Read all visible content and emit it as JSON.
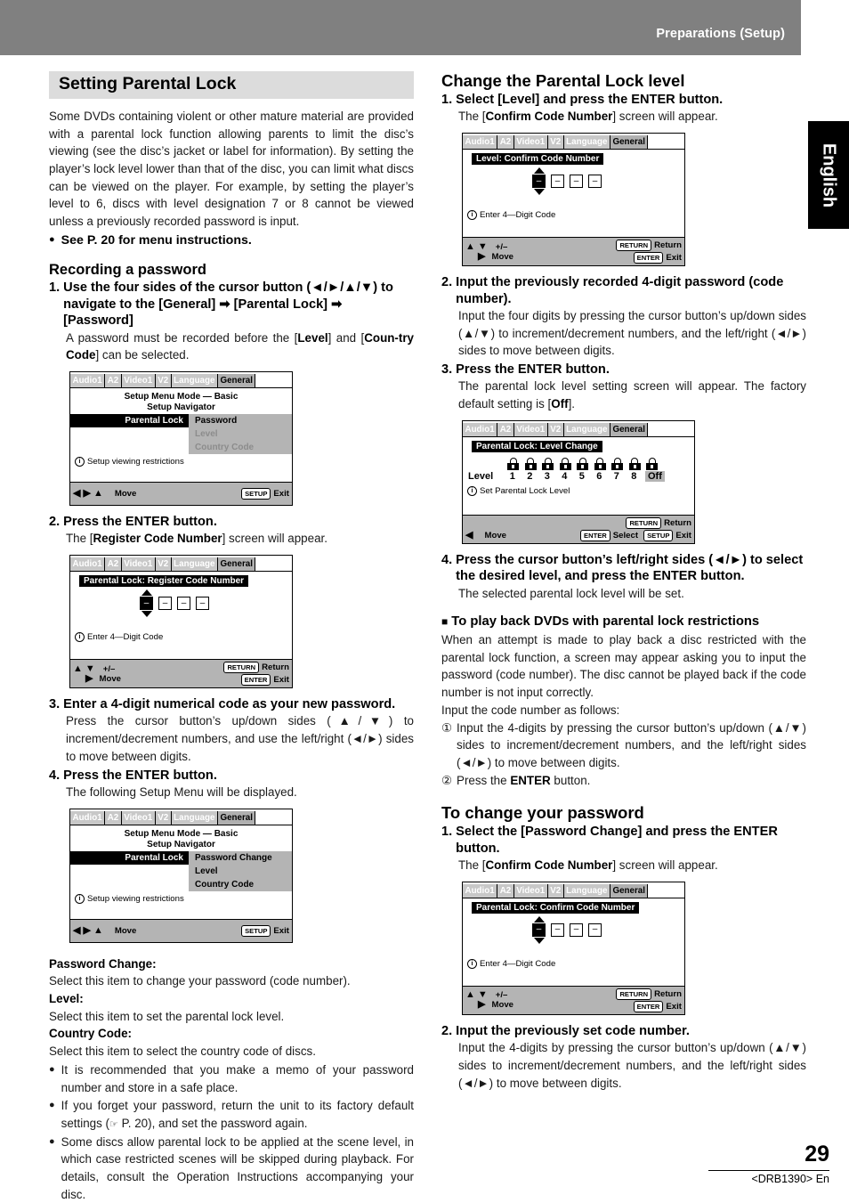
{
  "header": {
    "title": "Preparations (Setup)"
  },
  "sidetab": {
    "label": "English"
  },
  "footer": {
    "page_number": "29",
    "model": "<DRB1390> En"
  },
  "left": {
    "section_title": "Setting Parental Lock",
    "intro": "Some DVDs containing violent or other mature material are provided with a parental lock function allowing parents to limit the disc’s viewing (see the disc’s jacket or label for information). By setting the player’s lock level lower than that of the disc, you can limit what discs can be viewed on the player. For example, by setting the player’s level to 6, discs with level designation 7 or 8 cannot be viewed unless a previously recorded password is input.",
    "intro_bullet": "See P. 20 for menu instructions.",
    "sub_title": "Recording a password",
    "step1_num": "1.",
    "step1_title": "Use the four sides of the cursor button (◄/►/▲/▼) to navigate to the [General] ➡ [Parental Lock] ➡ [Password]",
    "step1_body_a": "A password must be recorded before the [",
    "step1_body_level": "Level",
    "step1_body_b": "] and [",
    "step1_body_country": "Coun-try Code",
    "step1_body_c": "] can be selected.",
    "step2_num": "2.",
    "step2_title": "Press the ENTER button.",
    "step2_body_a": "The [",
    "step2_body_b": "Register Code Number",
    "step2_body_c": "] screen will appear.",
    "step3_num": "3.",
    "step3_title": "Enter a 4-digit numerical code as your new password.",
    "step3_body": "Press the cursor button’s up/down sides (▲/▼) to increment/decrement numbers, and use the left/right (◄/►) sides to move between digits.",
    "step4_num": "4.",
    "step4_title": "Press the ENTER button.",
    "step4_body": "The following Setup Menu will be displayed.",
    "def_pwd_label": "Password Change:",
    "def_pwd_text": "Select this item to change your password (code number).",
    "def_level_label": "Level:",
    "def_level_text": "Select this item to set the parental lock level.",
    "def_country_label": "Country Code:",
    "def_country_text": "Select this item to select the country code of discs.",
    "bullet1": "It is recommended that you make a memo of your password number and store in a safe place.",
    "bullet2a": "If you forget your password, return the unit to its factory default settings (",
    "bullet2icon": "☞",
    "bullet2b": " P. 20), and set the password again.",
    "bullet3": "Some discs allow parental lock to be applied at the scene level, in which case restricted scenes will be skipped during playback. For details, consult the Operation Instructions accompanying your disc."
  },
  "right": {
    "section_title": "Change the Parental Lock level",
    "step1_num": "1.",
    "step1_title": "Select [Level] and press the ENTER button.",
    "step1_body_a": "The [",
    "step1_body_b": "Confirm Code Number",
    "step1_body_c": "] screen will appear.",
    "step2_num": "2.",
    "step2_title": "Input the previously recorded 4-digit password (code number).",
    "step2_body": "Input the four digits by pressing the cursor button’s up/down sides (▲/▼) to increment/decrement numbers, and the left/right (◄/►) sides to move between digits.",
    "step3_num": "3.",
    "step3_title": "Press the ENTER button.",
    "step3_body_a": "The parental lock level setting screen will appear. The factory default setting is [",
    "step3_body_b": "Off",
    "step3_body_c": "].",
    "step4_num": "4.",
    "step4_title": "Press the cursor button’s left/right sides (◄/►) to select the desired level, and press the ENTER button.",
    "step4_body": "The selected parental lock level will be set.",
    "playback_head": "To play back DVDs with parental lock restrictions",
    "playback_body": "When an attempt is made to play back a disc restricted with the parental lock function, a screen may appear asking you to input the password (code number). The disc cannot be played back if the code number is not input correctly.",
    "playback_follow": "Input the code number as follows:",
    "pb1_num": "①",
    "pb1_text": "Input the 4-digits by pressing the cursor button’s up/down (▲/▼) sides to increment/decrement numbers, and the left/right sides (◄/►) to move between digits.",
    "pb2_num": "②",
    "pb2_a": "Press the ",
    "pb2_b": "ENTER",
    "pb2_c": " button.",
    "change_title": "To change your password",
    "c1_num": "1.",
    "c1_title": "Select the [Password Change] and press the ENTER button.",
    "c1_body_a": "The [",
    "c1_body_b": "Confirm Code Number",
    "c1_body_c": "] screen will appear.",
    "c2_num": "2.",
    "c2_title": "Input the previously set code number.",
    "c2_body": "Input the 4-digits by pressing the cursor button’s up/down (▲/▼) sides to increment/decrement numbers, and the left/right sides (◄/►) to move between digits."
  },
  "osd": {
    "tabs": [
      "Audio1",
      "A2",
      "Video1",
      "V2",
      "Language",
      "General"
    ],
    "active_tab": "General",
    "screen1": {
      "line1_a": "Setup Menu Mode — ",
      "line1_b": "Basic",
      "line2": "Setup Navigator",
      "row_label": "Parental Lock",
      "items": [
        "Password",
        "Level",
        "Country Code"
      ],
      "info": "Setup viewing restrictions",
      "info_icon": "i",
      "foot_move": "Move",
      "foot_key": "SETUP",
      "foot_action": "Exit"
    },
    "screen2": {
      "title": "Parental Lock: Register Code Number",
      "digits": [
        "–",
        "–",
        "–",
        "–"
      ],
      "info": "Enter 4—Digit Code",
      "info_icon": "i",
      "foot_plusminus": "+/–",
      "foot_move": "Move",
      "foot_key1": "RETURN",
      "foot_action1": "Return",
      "foot_key2": "ENTER",
      "foot_action2": "Exit"
    },
    "screen3": {
      "line1_a": "Setup Menu Mode — ",
      "line1_b": "Basic",
      "line2": "Setup Navigator",
      "row_label": "Parental Lock",
      "items": [
        "Password Change",
        "Level",
        "Country Code"
      ],
      "info": "Setup viewing restrictions",
      "info_icon": "i",
      "foot_move": "Move",
      "foot_key": "SETUP",
      "foot_action": "Exit"
    },
    "screen4": {
      "title": "Level: Confirm Code Number",
      "digits": [
        "–",
        "–",
        "–",
        "–"
      ],
      "info": "Enter 4—Digit Code",
      "info_icon": "i",
      "foot_plusminus": "+/–",
      "foot_move": "Move",
      "foot_key1": "RETURN",
      "foot_action1": "Return",
      "foot_key2": "ENTER",
      "foot_action2": "Exit"
    },
    "screen5": {
      "title": "Parental Lock: Level Change",
      "level_label": "Level",
      "levels": [
        "1",
        "2",
        "3",
        "4",
        "5",
        "6",
        "7",
        "8"
      ],
      "off_label": "Off",
      "selected": "Off",
      "info": "Set Parental Lock Level",
      "info_icon": "i",
      "foot_move": "Move",
      "foot_key1": "RETURN",
      "foot_action1": "Return",
      "foot_key2": "ENTER",
      "foot_action2": "Select",
      "foot_key3": "SETUP",
      "foot_action3": "Exit"
    },
    "screen6": {
      "title": "Parental Lock: Confirm Code Number",
      "digits": [
        "–",
        "–",
        "–",
        "–"
      ],
      "info": "Enter 4—Digit Code",
      "info_icon": "i",
      "foot_plusminus": "+/–",
      "foot_move": "Move",
      "foot_key1": "RETURN",
      "foot_action1": "Return",
      "foot_key2": "ENTER",
      "foot_action2": "Exit"
    }
  },
  "colors": {
    "header_gray": "#808080",
    "band_gray": "#dcdcdc",
    "osd_foot": "#b4b4b4",
    "osd_menu": "#b4b4b4"
  }
}
